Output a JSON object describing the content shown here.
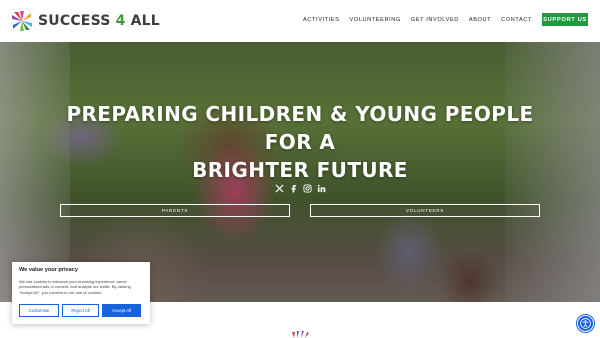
{
  "brand": {
    "name_part1": "SUCCESS",
    "name_part2": "4",
    "name_part3": "ALL",
    "colors": {
      "green": "#1f9a3e",
      "text": "#3c3c3c",
      "link_blue": "#1863dc"
    }
  },
  "nav": {
    "items": [
      "ACTIVITIES",
      "VOLUNTEERING",
      "GET INVOLVED",
      "ABOUT",
      "CONTACT"
    ],
    "cta": "SUPPORT US"
  },
  "hero": {
    "title_line1": "PREPARING CHILDREN & YOUNG PEOPLE FOR A",
    "title_line2": "BRIGHTER FUTURE",
    "socials": [
      "x-icon",
      "facebook-icon",
      "instagram-icon",
      "linkedin-icon"
    ],
    "buttons": {
      "parents": "PARENTS",
      "volunteers": "VOLUNTEERS"
    }
  },
  "cookie": {
    "title": "We value your privacy",
    "text": "We use cookies to enhance your browsing experience, serve personalised ads or content, and analyse our traffic. By clicking \"Accept All\", you consent to our use of cookies.",
    "customise": "Customise",
    "reject": "Reject All",
    "accept": "Accept All"
  },
  "accessibility": {
    "icon": "accessibility-icon"
  }
}
